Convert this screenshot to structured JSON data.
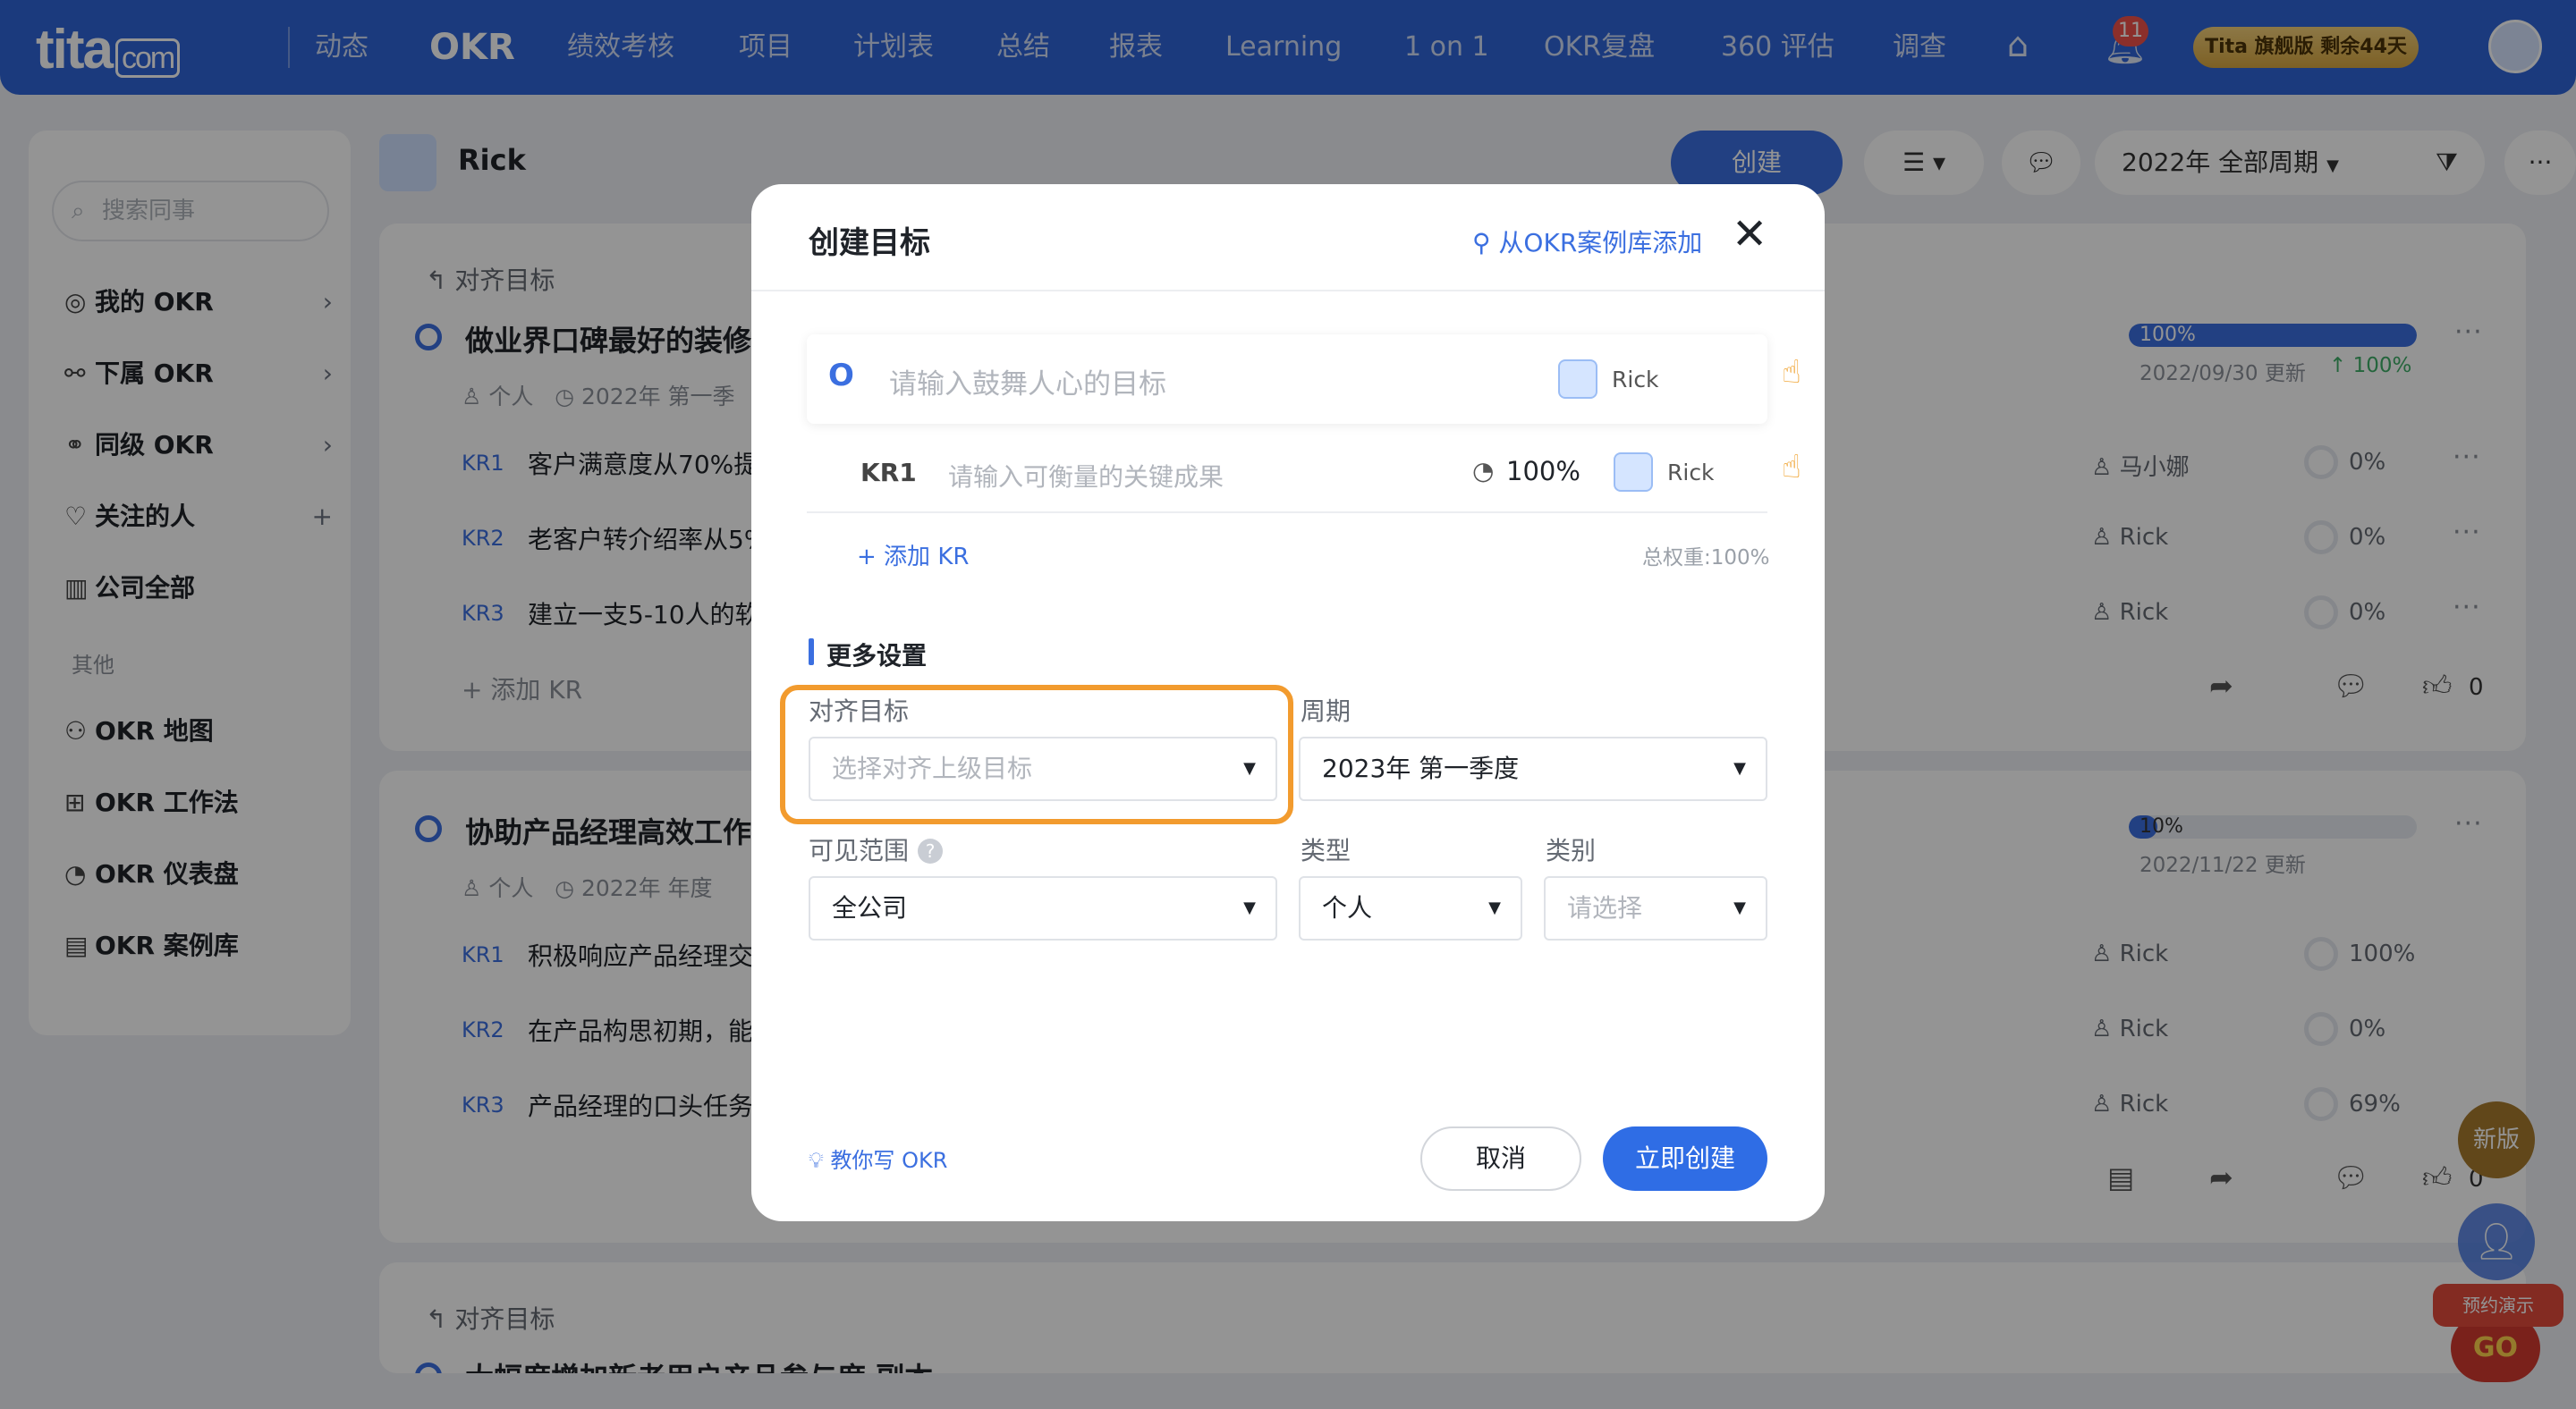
{
  "nav": {
    "logo": "tita",
    "logo_suffix": "com",
    "items": [
      "动态",
      "OKR",
      "绩效考核",
      "项目",
      "计划表",
      "总结",
      "报表",
      "Learning",
      "1 on 1",
      "OKR复盘",
      "360 评估",
      "调查"
    ],
    "active": "OKR",
    "notification_count": "11",
    "trial_text": "Tita 旗舰版 剩余44天"
  },
  "sidebar": {
    "search_placeholder": "搜索同事",
    "items": [
      {
        "label": "我的 OKR",
        "icon": "target-icon"
      },
      {
        "label": "下属 OKR",
        "icon": "org-icon"
      },
      {
        "label": "同级 OKR",
        "icon": "peers-icon"
      },
      {
        "label": "关注的人",
        "icon": "heart-icon"
      },
      {
        "label": "公司全部",
        "icon": "building-icon"
      }
    ],
    "group_other": "其他",
    "other_items": [
      {
        "label": "OKR 地图",
        "icon": "map-icon"
      },
      {
        "label": "OKR 工作法",
        "icon": "grid-icon"
      },
      {
        "label": "OKR 仪表盘",
        "icon": "gauge-icon"
      },
      {
        "label": "OKR 案例库",
        "icon": "library-icon"
      }
    ]
  },
  "page": {
    "user": "Rick",
    "create_label": "创建",
    "period_label": "2022年 全部周期"
  },
  "cards": [
    {
      "align_label": "对齐目标",
      "title": "做业界口碑最好的装修",
      "owner_type": "个人",
      "period": "2022年 第一季",
      "progress_label": "100%",
      "progress": 1.0,
      "updated": "2022/09/30 更新",
      "delta": "↑ 100%",
      "krs": [
        {
          "tag": "KR1",
          "text": "客户满意度从70%提",
          "owner": "马小娜",
          "pct": "0%"
        },
        {
          "tag": "KR2",
          "text": "老客户转介绍率从5%",
          "owner": "Rick",
          "pct": "0%"
        },
        {
          "tag": "KR3",
          "text": "建立一支5-10人的软",
          "owner": "Rick",
          "pct": "0%"
        }
      ],
      "add_kr": "+ 添加 KR",
      "likes": "0"
    },
    {
      "title": "协助产品经理高效工作",
      "owner_type": "个人",
      "period": "2022年 年度",
      "progress_label": "10%",
      "progress": 0.1,
      "updated": "2022/11/22 更新",
      "krs": [
        {
          "tag": "KR1",
          "text": "积极响应产品经理交",
          "owner": "Rick",
          "pct": "100%"
        },
        {
          "tag": "KR2",
          "text": "在产品构思初期，能",
          "owner": "Rick",
          "pct": "0%"
        },
        {
          "tag": "KR3",
          "text": "产品经理的口头任务",
          "owner": "Rick",
          "pct": "69%"
        }
      ],
      "likes": "0"
    },
    {
      "align_label": "对齐目标",
      "title": "大幅度增加新老用户产品参与度 副本"
    }
  ],
  "modal": {
    "title": "创建目标",
    "library_link": "从OKR案例库添加",
    "objective_letter": "O",
    "objective_placeholder": "请输入鼓舞人心的目标",
    "owner": "Rick",
    "kr_label": "KR1",
    "kr_placeholder": "请输入可衡量的关键成果",
    "kr_weight": "100%",
    "add_kr": "+ 添加 KR",
    "total_weight": "总权重:100%",
    "more_settings": "更多设置",
    "align_label": "对齐目标",
    "align_placeholder": "选择对齐上级目标",
    "period_label": "周期",
    "period_value": "2023年 第一季度",
    "visibility_label": "可见范围",
    "visibility_value": "全公司",
    "type_label": "类型",
    "type_value": "个人",
    "category_label": "类别",
    "category_placeholder": "请选择",
    "teach_link": "教你写 OKR",
    "cancel": "取消",
    "submit": "立即创建"
  },
  "floating": {
    "new_version": "新版",
    "demo": "预约演示",
    "go": "GO"
  },
  "colors": {
    "brand": "#2f64d8",
    "primary_button": "#2f6de5",
    "highlight": "#f29b2e"
  }
}
